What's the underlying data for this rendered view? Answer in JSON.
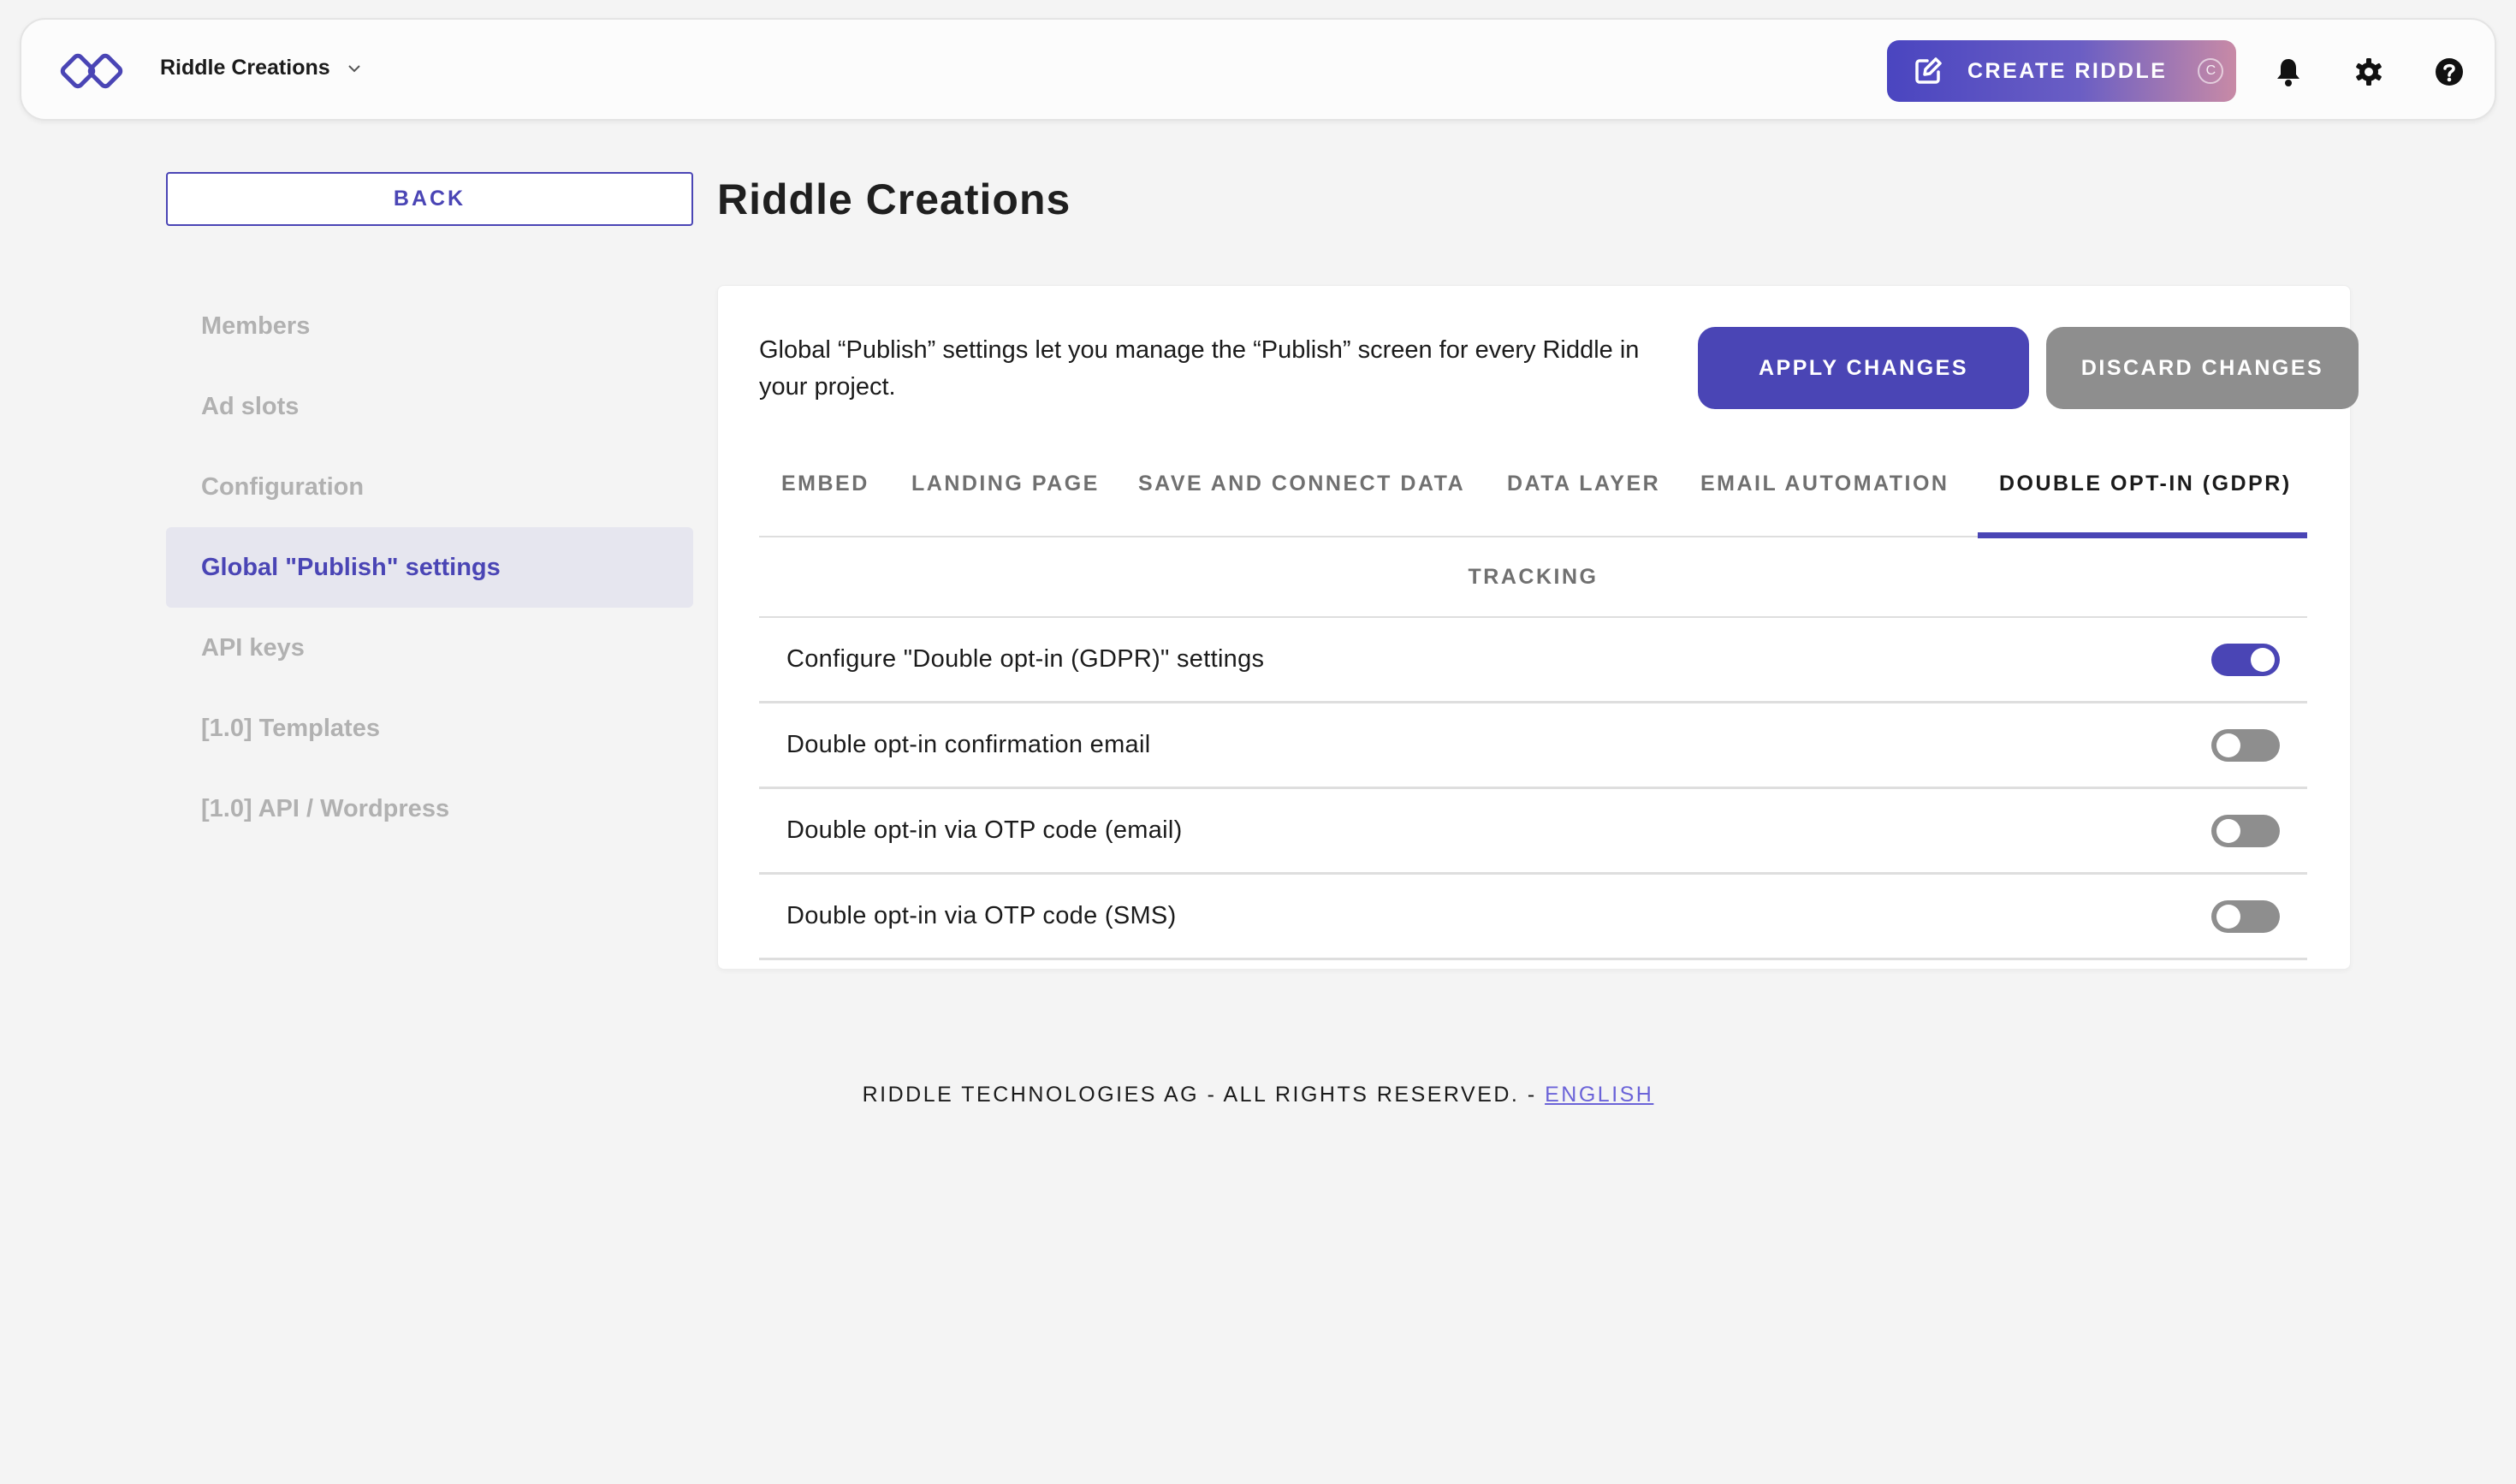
{
  "header": {
    "workspace_name": "Riddle Creations",
    "create_label": "CREATE RIDDLE",
    "create_shortcut": "C",
    "icons": [
      "logo-icon",
      "chevron-down-icon",
      "edit-icon",
      "bell-icon",
      "gear-icon",
      "help-icon"
    ],
    "accent_color": "#4a45b5"
  },
  "sidebar": {
    "back_label": "BACK",
    "items": [
      {
        "label": "Members",
        "active": false
      },
      {
        "label": "Ad slots",
        "active": false
      },
      {
        "label": "Configuration",
        "active": false
      },
      {
        "label": "Global \"Publish\" settings",
        "active": true
      },
      {
        "label": "API keys",
        "active": false
      },
      {
        "label": "[1.0] Templates",
        "active": false
      },
      {
        "label": "[1.0] API / Wordpress",
        "active": false
      }
    ]
  },
  "main": {
    "title": "Riddle Creations",
    "description": "Global “Publish” settings let you manage the “Publish” screen for every Riddle in your project.",
    "apply_label": "APPLY CHANGES",
    "discard_label": "DISCARD CHANGES",
    "tabs": [
      {
        "label": "EMBED",
        "active": false
      },
      {
        "label": "LANDING PAGE",
        "active": false
      },
      {
        "label": "SAVE AND CONNECT DATA",
        "active": false
      },
      {
        "label": "DATA LAYER",
        "active": false
      },
      {
        "label": "EMAIL AUTOMATION",
        "active": false
      },
      {
        "label": "DOUBLE OPT-IN (GDPR)",
        "active": true
      },
      {
        "label": "TRACKING",
        "active": false
      }
    ],
    "options": [
      {
        "label": "Configure \"Double opt-in (GDPR)\" settings",
        "enabled": true
      },
      {
        "label": "Double opt-in confirmation email",
        "enabled": false
      },
      {
        "label": "Double opt-in via OTP code (email)",
        "enabled": false
      },
      {
        "label": "Double opt-in via OTP code (SMS)",
        "enabled": false
      }
    ]
  },
  "footer": {
    "text": "RIDDLE TECHNOLOGIES AG - ALL RIGHTS RESERVED. - ",
    "language_link": "ENGLISH"
  }
}
